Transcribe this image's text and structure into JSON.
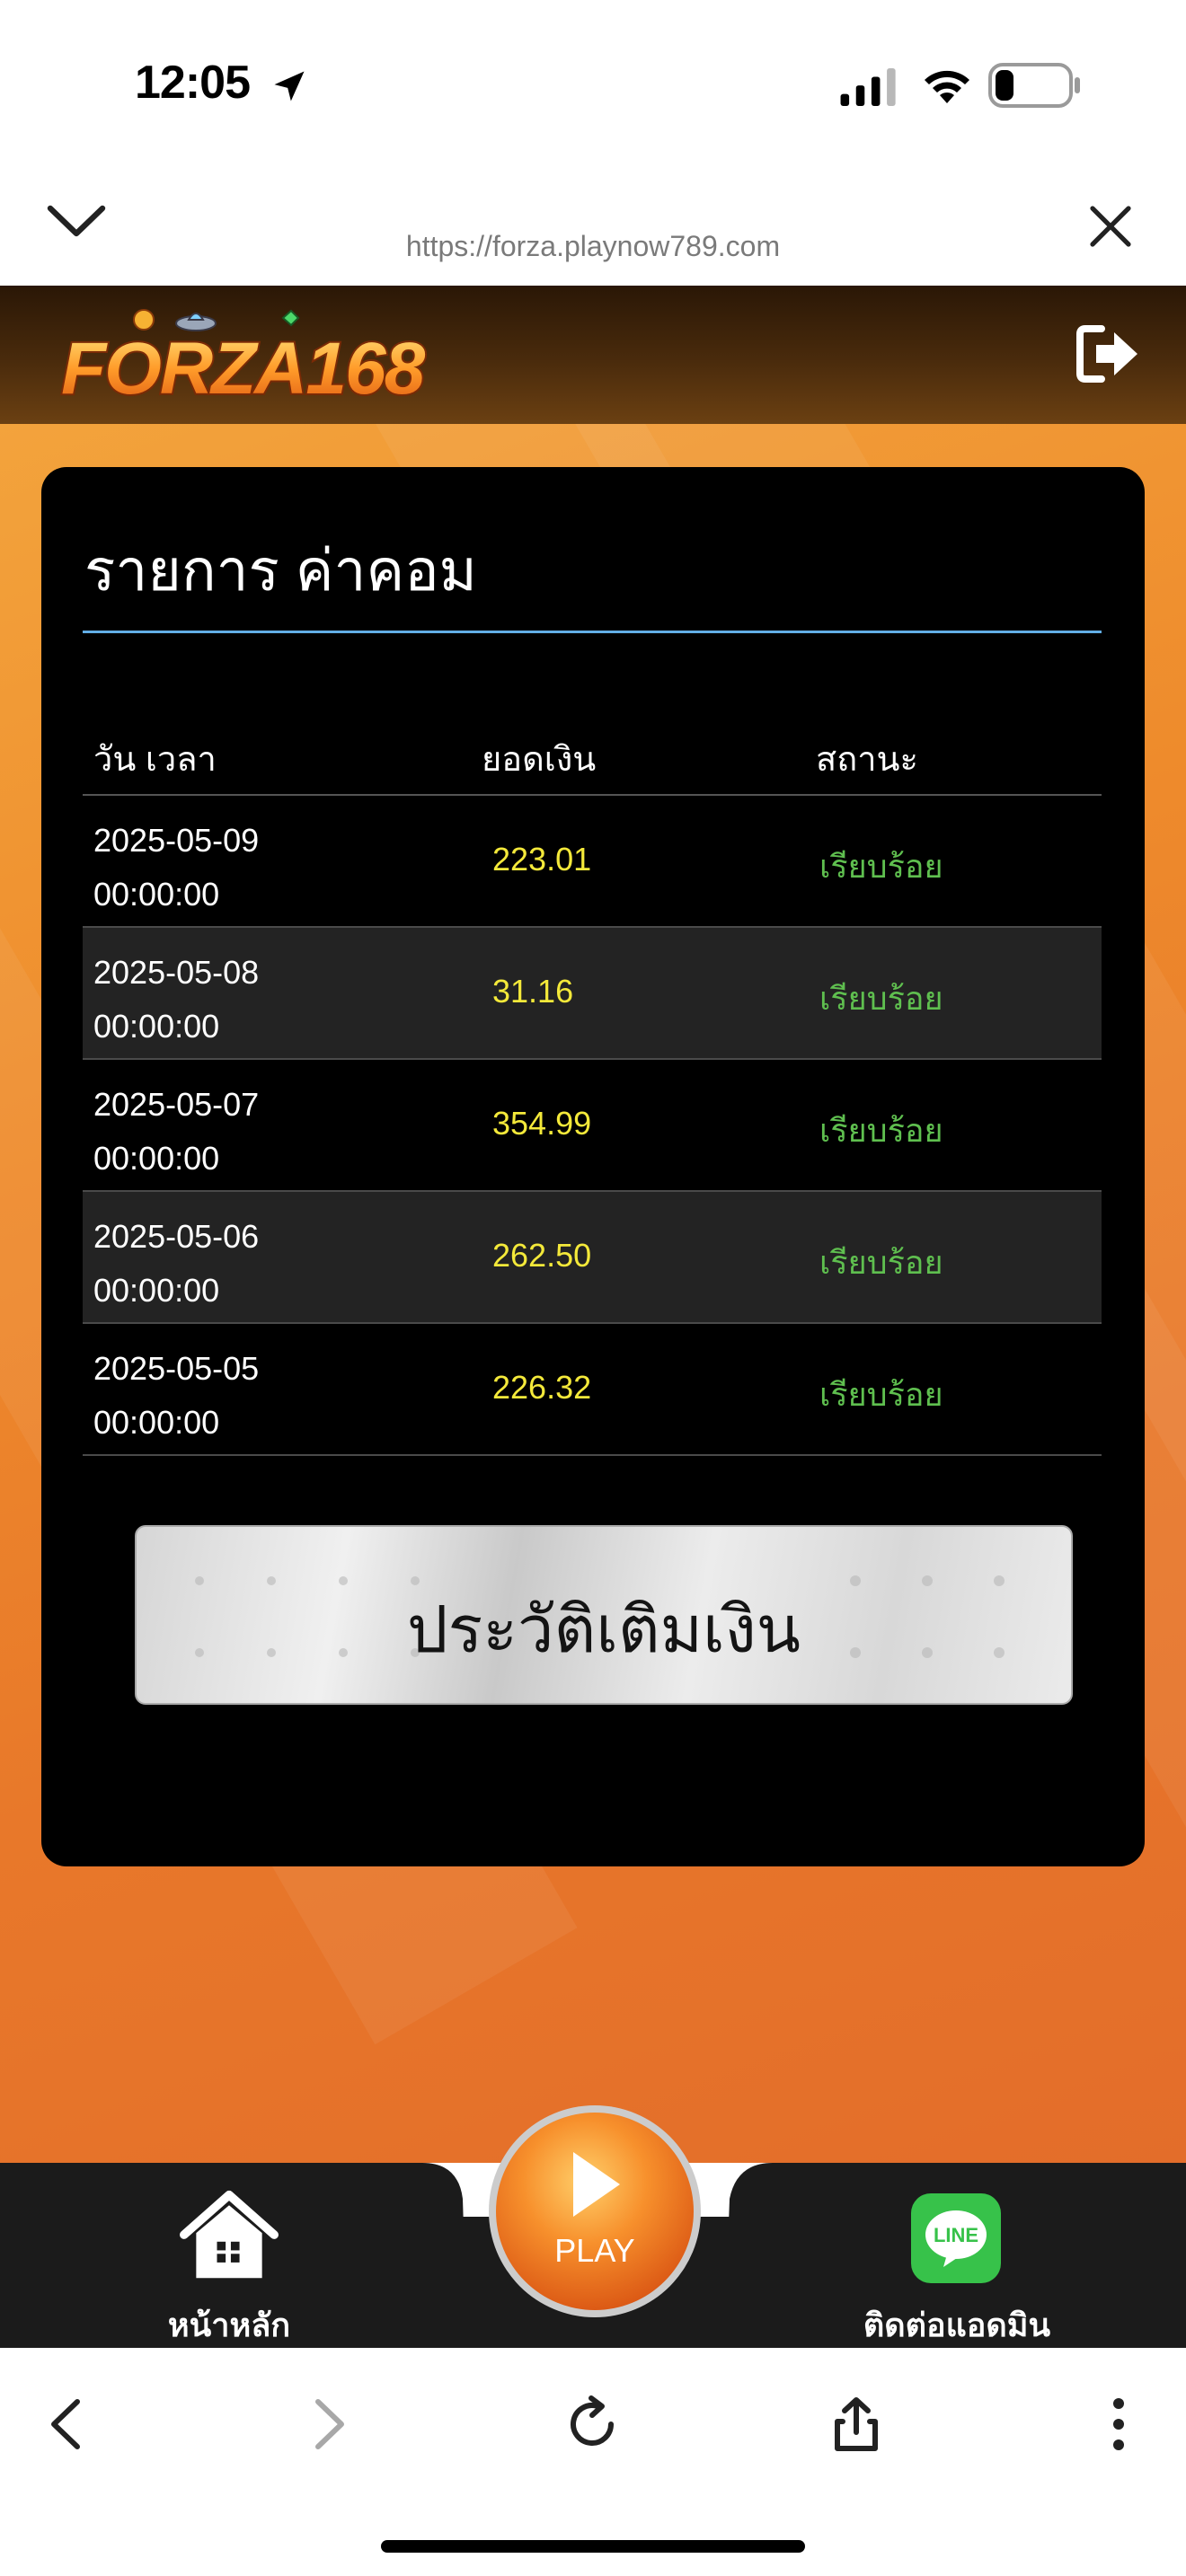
{
  "status_bar": {
    "time": "12:05"
  },
  "browser": {
    "url": "https://forza.playnow789.com"
  },
  "site": {
    "logo_text": "FORZA168"
  },
  "panel": {
    "title": "รายการ ค่าคอม",
    "columns": [
      "วัน เวลา",
      "ยอดเงิน",
      "สถานะ"
    ],
    "rows": [
      {
        "date": "2025-05-09",
        "time": "00:00:00",
        "amount": "223.01",
        "status": "เรียบร้อย"
      },
      {
        "date": "2025-05-08",
        "time": "00:00:00",
        "amount": "31.16",
        "status": "เรียบร้อย"
      },
      {
        "date": "2025-05-07",
        "time": "00:00:00",
        "amount": "354.99",
        "status": "เรียบร้อย"
      },
      {
        "date": "2025-05-06",
        "time": "00:00:00",
        "amount": "262.50",
        "status": "เรียบร้อย"
      },
      {
        "date": "2025-05-05",
        "time": "00:00:00",
        "amount": "226.32",
        "status": "เรียบร้อย"
      }
    ],
    "history_button": "ประวัติเติมเงิน"
  },
  "bottom_nav": {
    "home_label": "หน้าหลัก",
    "play_label": "PLAY",
    "contact_label": "ติดต่อแอดมิน",
    "line_badge": "LINE"
  },
  "colors": {
    "amount": "#f4e93a",
    "status_ok": "#5fbf4f",
    "divider": "#62aee6",
    "accent": "#ee8b2c"
  }
}
